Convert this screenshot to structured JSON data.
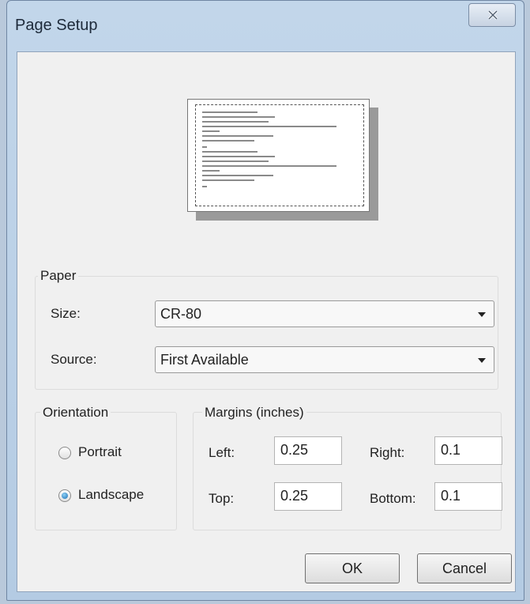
{
  "window": {
    "title": "Page Setup"
  },
  "paper": {
    "group_label": "Paper",
    "size_label": "Size:",
    "size_value": "CR-80",
    "source_label": "Source:",
    "source_value": "First Available"
  },
  "orientation": {
    "group_label": "Orientation",
    "portrait_label": "Portrait",
    "landscape_label": "Landscape",
    "selected": "Landscape"
  },
  "margins": {
    "group_label": "Margins (inches)",
    "left_label": "Left:",
    "left_value": "0.25",
    "right_label": "Right:",
    "right_value": "0.1",
    "top_label": "Top:",
    "top_value": "0.25",
    "bottom_label": "Bottom:",
    "bottom_value": "0.1"
  },
  "buttons": {
    "ok": "OK",
    "cancel": "Cancel"
  },
  "icons": {
    "close": "close-icon",
    "dropdown": "chevron-down-icon"
  }
}
